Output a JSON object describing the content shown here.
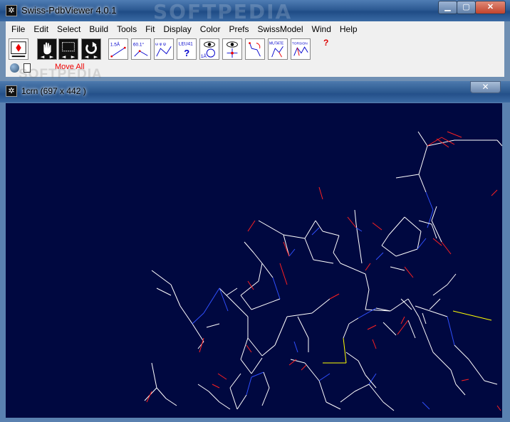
{
  "app": {
    "title": "Swiss-PdbViewer 4.0.1",
    "watermark": "SOFTPEDIA"
  },
  "window_controls": [
    "minimize",
    "maximize",
    "close"
  ],
  "menu": [
    "File",
    "Edit",
    "Select",
    "Build",
    "Tools",
    "Fit",
    "Display",
    "Color",
    "Prefs",
    "SwissModel",
    "Wind",
    "Help"
  ],
  "toolbar": {
    "tools": [
      {
        "name": "center-tool",
        "label": ""
      },
      {
        "name": "move-hand-tool",
        "label": ""
      },
      {
        "name": "zoom-tool",
        "label": ""
      },
      {
        "name": "rotate-tool",
        "label": ""
      },
      {
        "name": "distance-tool",
        "label": "1.5Å"
      },
      {
        "name": "angle-tool",
        "label": "60.1°"
      },
      {
        "name": "dihedral-tool",
        "label": "ω φ ψ"
      },
      {
        "name": "identify-tool",
        "label": "LEU41"
      },
      {
        "name": "distance-range-tool",
        "label": "1Å"
      },
      {
        "name": "center-atom-tool",
        "label": ""
      },
      {
        "name": "fix-tool",
        "label": ""
      },
      {
        "name": "mutate-tool",
        "label": "MUTATE"
      },
      {
        "name": "torsion-tool",
        "label": "TORSION"
      }
    ],
    "help_symbol": "?",
    "move_all_label": "Move All"
  },
  "child_window": {
    "title": "1crn  (697 x 442 )",
    "watermark": "SOFTPEDIA"
  },
  "colors": {
    "viewport_bg": "#000840",
    "carbon": "#ffffff",
    "oxygen": "#ff2020",
    "nitrogen": "#3050ff",
    "sulfur": "#ffff00",
    "move_all": "#ee0000"
  }
}
